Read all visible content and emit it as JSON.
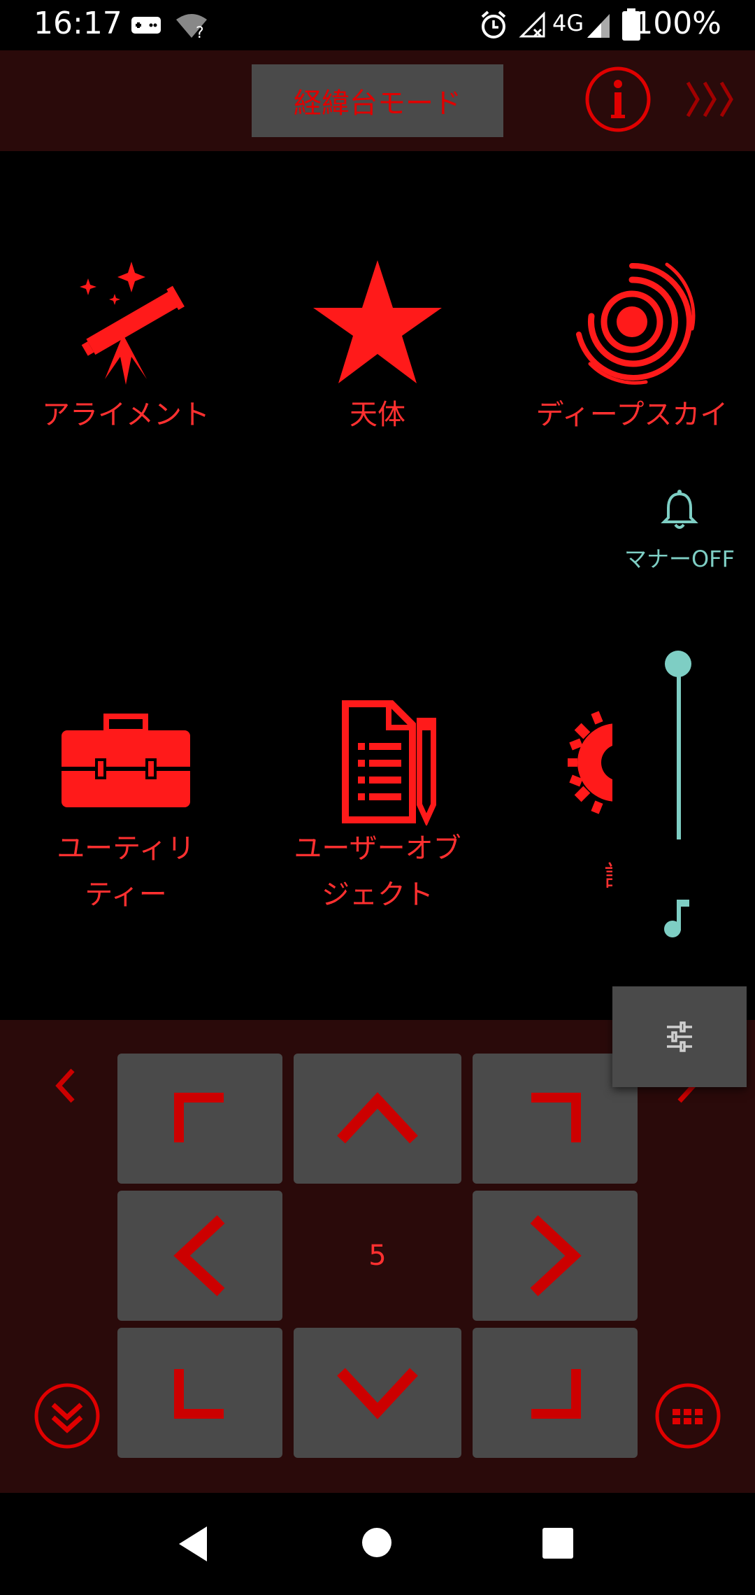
{
  "status_bar": {
    "time": "16:17",
    "network": "4G",
    "battery": "100%"
  },
  "header": {
    "mode_label": "経緯台モード",
    "info_icon": "info-icon",
    "forward_icon": "triple-chevron-right-icon"
  },
  "menu": {
    "items": [
      {
        "label": "アライメント",
        "icon": "telescope-icon"
      },
      {
        "label": "天体",
        "icon": "star-icon"
      },
      {
        "label": "ディープスカイ",
        "icon": "galaxy-icon"
      },
      {
        "label": "ユーティリ\nティー",
        "icon": "toolbox-icon"
      },
      {
        "label": "ユーザーオブ\nジェクト",
        "icon": "document-pencil-icon"
      },
      {
        "label": "設",
        "icon": "gear-icon"
      }
    ]
  },
  "volume_overlay": {
    "manner_label": "マナーOFF",
    "volume_level": 1.0
  },
  "controls": {
    "speed_value": "5"
  },
  "colors": {
    "accent_red": "#ff1a1a",
    "teal": "#7ecec4",
    "panel_bg": "#2a0a0a",
    "button_bg": "#4a4a4a"
  }
}
